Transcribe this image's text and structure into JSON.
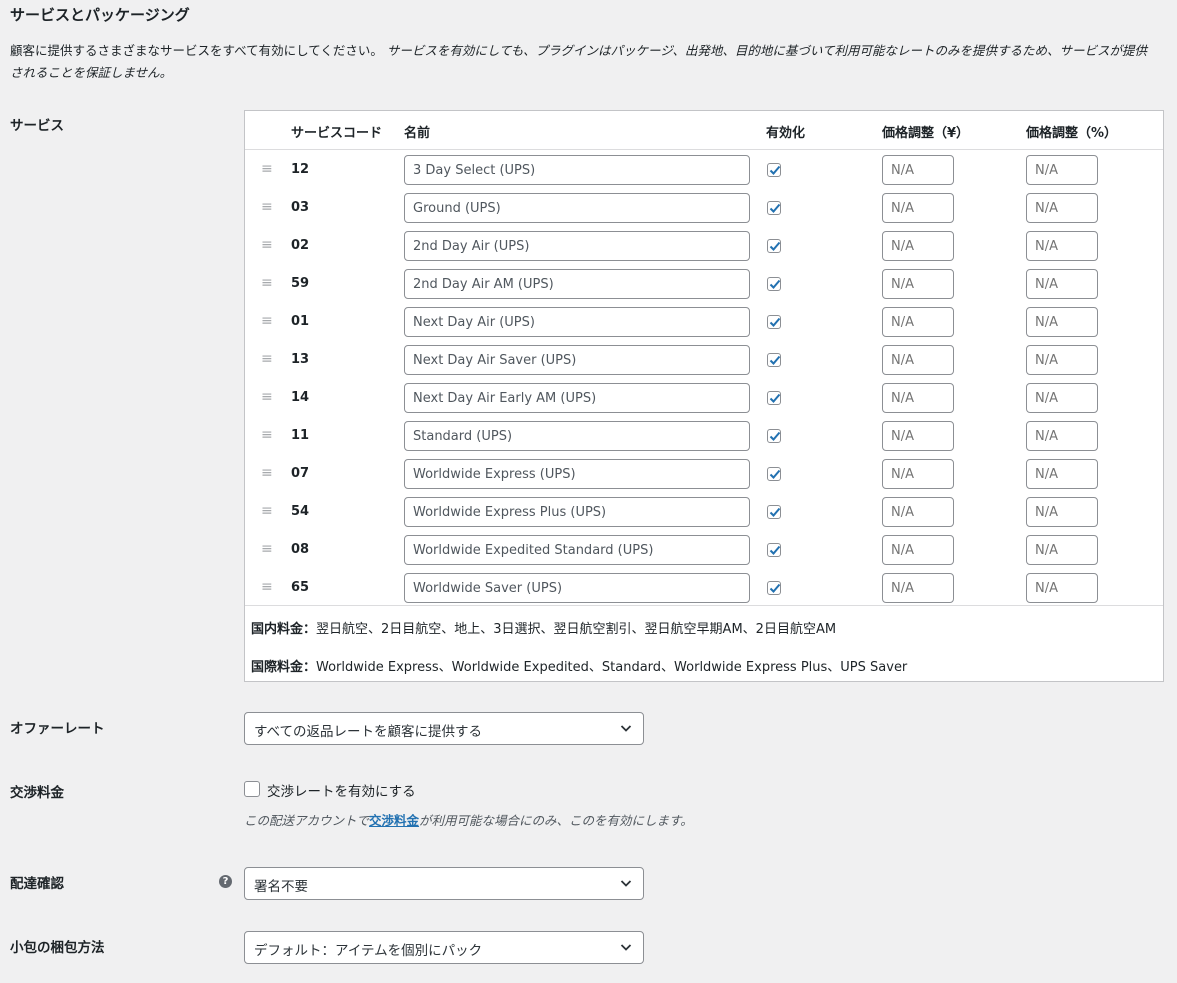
{
  "section": {
    "title": "サービスとパッケージング",
    "description_plain": "顧客に提供するさまざまなサービスをすべて有効にしてください。",
    "description_italic_1": "サービスを有効にしても、プラグインはパッケージ、出発地、目的地に基づいて利用可能なレートのみを提供するため、サービスが提供",
    "description_italic_2": "されることを保証しません。"
  },
  "services": {
    "label": "サービス",
    "headers": {
      "code": "サービスコード",
      "name": "名前",
      "enabled": "有効化",
      "price_adj_yen": "価格調整（¥）",
      "price_adj_pct": "価格調整（%）"
    },
    "adj_placeholder": "N/A",
    "rows": [
      {
        "code": "12",
        "name": "3 Day Select (UPS)",
        "enabled": true
      },
      {
        "code": "03",
        "name": "Ground (UPS)",
        "enabled": true
      },
      {
        "code": "02",
        "name": "2nd Day Air (UPS)",
        "enabled": true
      },
      {
        "code": "59",
        "name": "2nd Day Air AM (UPS)",
        "enabled": true
      },
      {
        "code": "01",
        "name": "Next Day Air (UPS)",
        "enabled": true
      },
      {
        "code": "13",
        "name": "Next Day Air Saver (UPS)",
        "enabled": true
      },
      {
        "code": "14",
        "name": "Next Day Air Early AM (UPS)",
        "enabled": true
      },
      {
        "code": "11",
        "name": "Standard (UPS)",
        "enabled": true
      },
      {
        "code": "07",
        "name": "Worldwide Express (UPS)",
        "enabled": true
      },
      {
        "code": "54",
        "name": "Worldwide Express Plus (UPS)",
        "enabled": true
      },
      {
        "code": "08",
        "name": "Worldwide Expedited Standard (UPS)",
        "enabled": true
      },
      {
        "code": "65",
        "name": "Worldwide Saver (UPS)",
        "enabled": true
      }
    ],
    "domestic_label": "国内料金：",
    "domestic_text": "翌日航空、2日目航空、地上、3日選択、翌日航空割引、翌日航空早期AM、2日目航空AM",
    "intl_label": "国際料金：",
    "intl_text": "Worldwide Express、Worldwide Expedited、Standard、Worldwide Express Plus、UPS Saver"
  },
  "offer_rates": {
    "label": "オファーレート",
    "value": "すべての返品レートを顧客に提供する"
  },
  "negotiated": {
    "label": "交渉料金",
    "checkbox_label": "交渉レートを有効にする",
    "checked": false,
    "note_before": "この配送アカウントで",
    "note_link": "交渉料金",
    "note_after": "が利用可能な場合にのみ、このを有効にします。"
  },
  "delivery_confirmation": {
    "label": "配達確認",
    "help_glyph": "?",
    "value": "署名不要"
  },
  "packing": {
    "label": "小包の梱包方法",
    "value": "デフォルト：アイテムを個別にパック"
  },
  "colors": {
    "accent": "#2271b1",
    "background": "#f0f0f1"
  },
  "icons": {
    "drag": "drag-handle-icon",
    "check": "checkmark-icon",
    "chevron": "chevron-down-icon",
    "help": "help-icon"
  }
}
